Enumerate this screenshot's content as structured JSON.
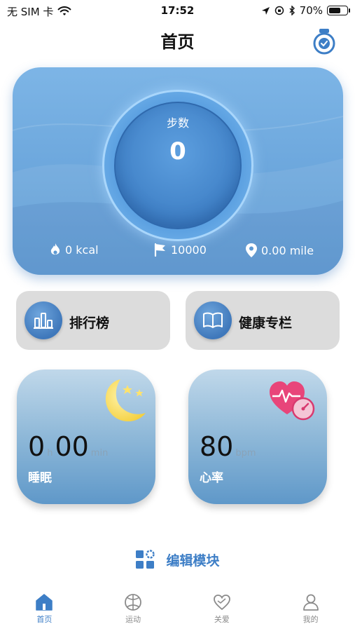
{
  "status_bar": {
    "carrier": "无 SIM 卡",
    "time": "17:52",
    "battery": "70%",
    "battery_level": 0.7
  },
  "header": {
    "title": "首页",
    "watch_icon": "watch-icon"
  },
  "steps_card": {
    "label": "步数",
    "value": "0",
    "calories": "0 kcal",
    "goal": "10000",
    "distance": "0.00 mile"
  },
  "shortcuts": [
    {
      "label": "排行榜",
      "icon": "bar-chart-icon"
    },
    {
      "label": "健康专栏",
      "icon": "book-icon"
    }
  ],
  "sleep": {
    "hours": "0",
    "hours_unit": "h",
    "minutes": "00",
    "minutes_unit": "min",
    "label": "睡眠",
    "icon": "moon-stars-icon"
  },
  "heart_rate": {
    "value": "80",
    "unit": "bpm",
    "label": "心率",
    "icon": "heart-gauge-icon"
  },
  "edit_modules": {
    "label": "编辑模块",
    "icon": "grid-settings-icon"
  },
  "tabs": [
    {
      "label": "首页",
      "icon": "home-icon",
      "active": true
    },
    {
      "label": "运动",
      "icon": "ball-icon",
      "active": false
    },
    {
      "label": "关爱",
      "icon": "heart-icon",
      "active": false
    },
    {
      "label": "我的",
      "icon": "person-icon",
      "active": false
    }
  ],
  "colors": {
    "accent": "#3d7ec6",
    "card_blue": "#5c99d3",
    "tile_gray": "#dcdcdc",
    "heart_pink": "#e8457a",
    "moon_yellow": "#f6d54a"
  }
}
